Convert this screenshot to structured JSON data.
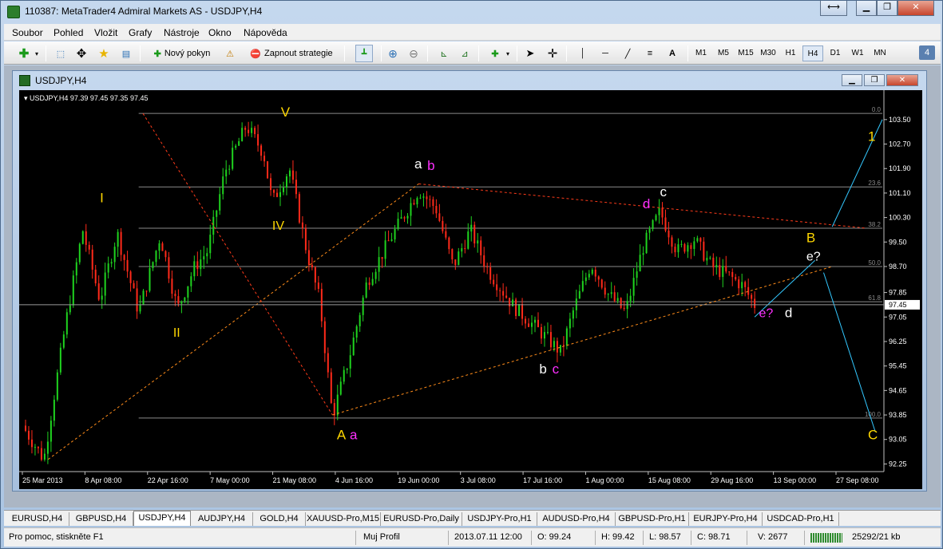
{
  "window": {
    "title": "110387: MetaTrader4 Admiral Markets AS - USDJPY,H4"
  },
  "menu": [
    "Soubor",
    "Pohled",
    "Vložit",
    "Grafy",
    "Nástroje",
    "Okno",
    "Nápověda"
  ],
  "toolbar": {
    "new_order": "Nový pokyn",
    "strategy": "Zapnout strategie",
    "text_tool": "A",
    "badge": "4"
  },
  "timeframes": [
    "M1",
    "M5",
    "M15",
    "M30",
    "H1",
    "H4",
    "D1",
    "W1",
    "MN"
  ],
  "active_timeframe": "H4",
  "chart_window": {
    "title": "USDJPY,H4"
  },
  "chart_data": {
    "type": "candlestick",
    "header": "USDJPY,H4  97.39 97.45 97.35 97.45",
    "y_ticks": [
      "103.50",
      "102.70",
      "101.90",
      "101.10",
      "100.30",
      "99.50",
      "98.70",
      "97.85",
      "97.05",
      "96.25",
      "95.45",
      "94.65",
      "93.85",
      "93.05",
      "92.25"
    ],
    "y_tick_values": [
      103.5,
      102.7,
      101.9,
      101.1,
      100.3,
      99.5,
      98.7,
      97.85,
      97.05,
      96.25,
      95.45,
      94.65,
      93.85,
      93.05,
      92.25
    ],
    "ylim": [
      92.0,
      104.2
    ],
    "current_price": "97.45",
    "x_ticks": [
      "25 Mar 2013",
      "8 Apr 08:00",
      "22 Apr 16:00",
      "7 May 00:00",
      "21 May 08:00",
      "4 Jun 16:00",
      "19 Jun 00:00",
      "3 Jul 08:00",
      "17 Jul 16:00",
      "1 Aug 00:00",
      "15 Aug 08:00",
      "29 Aug 16:00",
      "13 Sep 00:00",
      "27 Sep 08:00"
    ],
    "fibo_levels": [
      {
        "label": "0.0",
        "price": 103.7
      },
      {
        "label": "23.6",
        "price": 101.3
      },
      {
        "label": "38.2",
        "price": 99.95
      },
      {
        "label": "50.0",
        "price": 98.7
      },
      {
        "label": "61.8",
        "price": 97.55
      },
      {
        "label": "100.0",
        "price": 93.75
      }
    ],
    "price_path": [
      [
        0,
        93.5
      ],
      [
        0.025,
        92.4
      ],
      [
        0.05,
        96.8
      ],
      [
        0.07,
        99.9
      ],
      [
        0.09,
        97.6
      ],
      [
        0.11,
        99.8
      ],
      [
        0.135,
        97.2
      ],
      [
        0.16,
        99.7
      ],
      [
        0.18,
        97.3
      ],
      [
        0.2,
        98.7
      ],
      [
        0.215,
        99.2
      ],
      [
        0.235,
        101.8
      ],
      [
        0.26,
        103.3
      ],
      [
        0.28,
        102.4
      ],
      [
        0.29,
        100.8
      ],
      [
        0.31,
        101.9
      ],
      [
        0.33,
        99.2
      ],
      [
        0.345,
        97.6
      ],
      [
        0.36,
        93.8
      ],
      [
        0.38,
        95.8
      ],
      [
        0.4,
        98.2
      ],
      [
        0.425,
        99.5
      ],
      [
        0.46,
        101.2
      ],
      [
        0.48,
        100.6
      ],
      [
        0.5,
        98.7
      ],
      [
        0.52,
        99.9
      ],
      [
        0.54,
        98.6
      ],
      [
        0.57,
        97.4
      ],
      [
        0.6,
        96.6
      ],
      [
        0.625,
        95.9
      ],
      [
        0.64,
        97.3
      ],
      [
        0.66,
        98.8
      ],
      [
        0.68,
        97.8
      ],
      [
        0.7,
        97.2
      ],
      [
        0.72,
        99.3
      ],
      [
        0.74,
        100.5
      ],
      [
        0.76,
        99.2
      ],
      [
        0.78,
        99.6
      ],
      [
        0.8,
        98.7
      ],
      [
        0.82,
        98.4
      ],
      [
        0.835,
        98.1
      ],
      [
        0.85,
        97.45
      ]
    ],
    "wave_labels": [
      {
        "text": "V",
        "x": 0.3,
        "y": 103.6,
        "color": "#ffd700"
      },
      {
        "text": "I",
        "x": 0.09,
        "y": 100.8,
        "color": "#ffd700"
      },
      {
        "text": "IV",
        "x": 0.29,
        "y": 99.9,
        "color": "#ffd700"
      },
      {
        "text": "II",
        "x": 0.175,
        "y": 96.4,
        "color": "#ffd700"
      },
      {
        "text": "A",
        "x": 0.365,
        "y": 93.05,
        "color": "#ffd700"
      },
      {
        "text": "a",
        "x": 0.38,
        "y": 93.05,
        "color": "#ff2fff"
      },
      {
        "text": "a",
        "x": 0.455,
        "y": 101.9,
        "color": "#ffffff"
      },
      {
        "text": "b",
        "x": 0.47,
        "y": 101.85,
        "color": "#ff2fff"
      },
      {
        "text": "b",
        "x": 0.6,
        "y": 95.2,
        "color": "#ffffff"
      },
      {
        "text": "c",
        "x": 0.615,
        "y": 95.2,
        "color": "#ff2fff"
      },
      {
        "text": "d",
        "x": 0.72,
        "y": 100.6,
        "color": "#ff2fff"
      },
      {
        "text": "c",
        "x": 0.74,
        "y": 101.0,
        "color": "#ffffff"
      },
      {
        "text": "B",
        "x": 0.91,
        "y": 99.5,
        "color": "#ffd700"
      },
      {
        "text": "e?",
        "x": 0.91,
        "y": 98.9,
        "color": "#ffffff"
      },
      {
        "text": "e?",
        "x": 0.855,
        "y": 97.05,
        "color": "#ff2fff"
      },
      {
        "text": "d",
        "x": 0.885,
        "y": 97.05,
        "color": "#ffffff"
      },
      {
        "text": "1",
        "x": 0.995,
        "y": 102.8,
        "color": "#ffd700"
      },
      {
        "text": "C",
        "x": 0.995,
        "y": 93.05,
        "color": "#ffd700"
      }
    ],
    "trendlines": [
      {
        "from": [
          0.03,
          92.4
        ],
        "to": [
          0.46,
          101.4
        ],
        "color": "#ff8c1a"
      },
      {
        "from": [
          0.14,
          103.7
        ],
        "to": [
          0.36,
          93.85
        ],
        "color": "#ff3b1a"
      },
      {
        "from": [
          0.36,
          93.85
        ],
        "to": [
          0.94,
          98.7
        ],
        "color": "#ff8c1a"
      },
      {
        "from": [
          0.46,
          101.4
        ],
        "to": [
          0.98,
          99.95
        ],
        "color": "#ff3b1a"
      }
    ],
    "projections": [
      {
        "from": [
          0.85,
          97.05
        ],
        "to": [
          0.92,
          98.9
        ],
        "color": "#33c8ff"
      },
      {
        "from": [
          0.94,
          100.0
        ],
        "to": [
          1.03,
          103.5
        ],
        "color": "#33c8ff"
      },
      {
        "from": [
          0.93,
          98.5
        ],
        "to": [
          0.99,
          93.3
        ],
        "color": "#33c8ff"
      }
    ]
  },
  "tabs": [
    "EURUSD,H4",
    "GBPUSD,H4",
    "USDJPY,H4",
    "AUDJPY,H4",
    "GOLD,H4",
    "XAUUSD-Pro,M15",
    "EURUSD-Pro,Daily",
    "USDJPY-Pro,H1",
    "AUDUSD-Pro,H4",
    "GBPUSD-Pro,H1",
    "EURJPY-Pro,H4",
    "USDCAD-Pro,H1"
  ],
  "active_tab": "USDJPY,H4",
  "status": {
    "help": "Pro pomoc, stiskněte F1",
    "profile": "Muj Profil",
    "datetime": "2013.07.11 12:00",
    "open": "O: 99.24",
    "high": "H: 99.42",
    "low": "L: 98.57",
    "close": "C: 98.71",
    "volume": "V: 2677",
    "traffic": "25292/21 kb"
  }
}
